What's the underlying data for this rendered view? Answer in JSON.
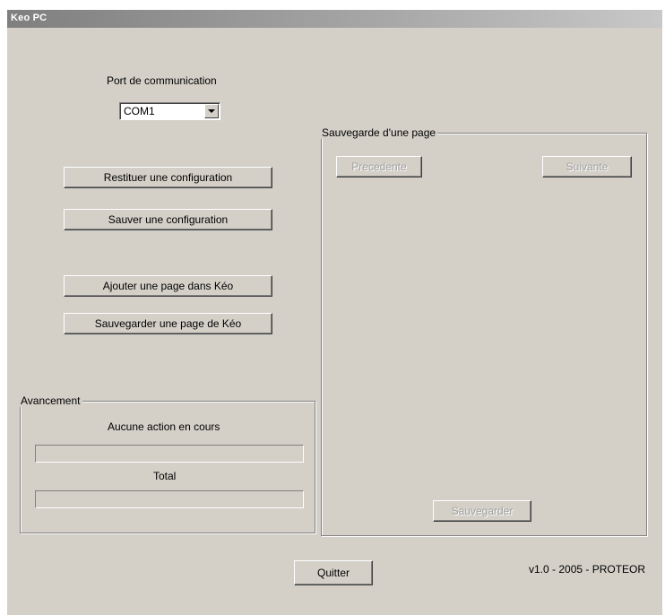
{
  "window": {
    "title": "Keo PC"
  },
  "port": {
    "label": "Port de communication",
    "selected": "COM1"
  },
  "buttons": {
    "restore": "Restituer une configuration",
    "save_config": "Sauver une configuration",
    "add_page": "Ajouter une page dans Kéo",
    "save_page": "Sauvegarder une page de Kéo",
    "quit": "Quitter"
  },
  "progress": {
    "group_label": "Avancement",
    "status": "Aucune action en cours",
    "action_fraction": 0,
    "total_label": "Total",
    "total_fraction": 0
  },
  "page_save": {
    "group_label": "Sauvegarde d'une page",
    "previous": "Precedente",
    "next": "Suivante",
    "save": "Sauvegarder"
  },
  "footer": {
    "version": "v1.0 - 2005 - PROTEOR"
  }
}
